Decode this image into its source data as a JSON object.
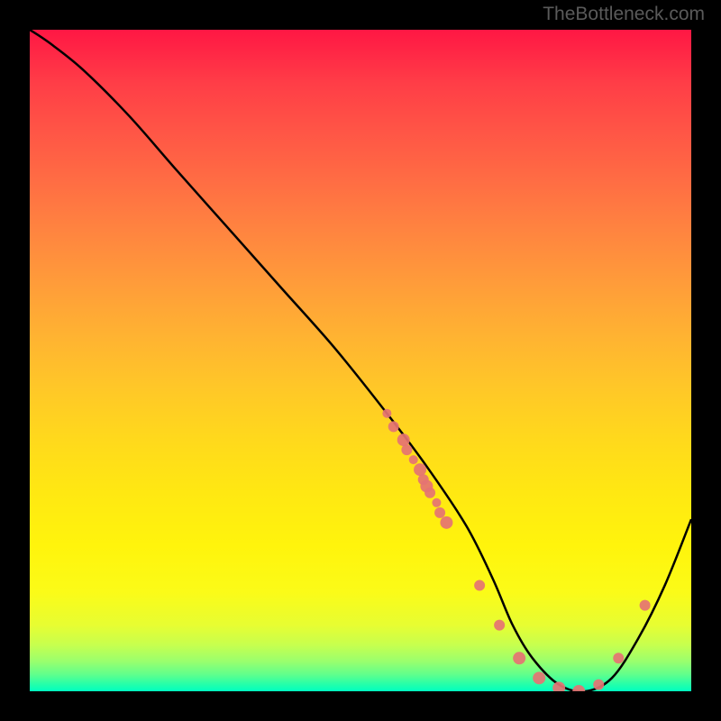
{
  "watermark": "TheBottleneck.com",
  "chart_data": {
    "type": "line",
    "title": "",
    "xlabel": "",
    "ylabel": "",
    "xlim": [
      0,
      100
    ],
    "ylim": [
      0,
      100
    ],
    "gradient_direction": "top_to_bottom",
    "gradient_meaning": "red=high bottleneck, green=low bottleneck",
    "series": [
      {
        "name": "bottleneck-curve",
        "color": "#000000",
        "x": [
          0,
          3,
          8,
          15,
          22,
          30,
          38,
          46,
          54,
          60,
          66,
          70,
          73,
          76,
          80,
          84,
          88,
          92,
          96,
          100
        ],
        "y": [
          100,
          98,
          94,
          87,
          79,
          70,
          61,
          52,
          42,
          34,
          25,
          17,
          10,
          5,
          1,
          0,
          2,
          8,
          16,
          26
        ]
      }
    ],
    "markers": {
      "name": "highlighted-points",
      "color": "#e57373",
      "shape": "circle",
      "points": [
        {
          "x": 54,
          "y": 42,
          "r": 5
        },
        {
          "x": 55,
          "y": 40,
          "r": 6
        },
        {
          "x": 56.5,
          "y": 38,
          "r": 7
        },
        {
          "x": 57,
          "y": 36.5,
          "r": 6
        },
        {
          "x": 58,
          "y": 35,
          "r": 5
        },
        {
          "x": 59,
          "y": 33.5,
          "r": 7
        },
        {
          "x": 59.5,
          "y": 32,
          "r": 6
        },
        {
          "x": 60,
          "y": 31,
          "r": 7
        },
        {
          "x": 60.5,
          "y": 30,
          "r": 6
        },
        {
          "x": 61.5,
          "y": 28.5,
          "r": 5
        },
        {
          "x": 62,
          "y": 27,
          "r": 6
        },
        {
          "x": 63,
          "y": 25.5,
          "r": 7
        },
        {
          "x": 68,
          "y": 16,
          "r": 6
        },
        {
          "x": 71,
          "y": 10,
          "r": 6
        },
        {
          "x": 74,
          "y": 5,
          "r": 7
        },
        {
          "x": 77,
          "y": 2,
          "r": 7
        },
        {
          "x": 80,
          "y": 0.5,
          "r": 7
        },
        {
          "x": 83,
          "y": 0,
          "r": 7
        },
        {
          "x": 86,
          "y": 1,
          "r": 6
        },
        {
          "x": 89,
          "y": 5,
          "r": 6
        },
        {
          "x": 93,
          "y": 13,
          "r": 6
        }
      ]
    }
  }
}
